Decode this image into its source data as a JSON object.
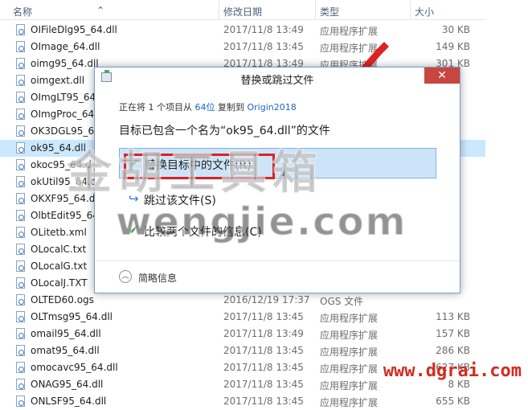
{
  "columns": {
    "name": "名称",
    "date": "修改日期",
    "type": "类型",
    "size": "大小"
  },
  "files": [
    {
      "name": "OIFileDlg95_64.dll",
      "date": "2017/11/8 13:49",
      "type": "应用程序扩展",
      "size": "30 KB"
    },
    {
      "name": "OImage_64.dll",
      "date": "2017/11/8 13:45",
      "type": "应用程序扩展",
      "size": "149 KB"
    },
    {
      "name": "oimg95_64.dll",
      "date": "2017/11/8 13:49",
      "type": "应用程序扩展",
      "size": "301 KB"
    },
    {
      "name": "oimgext.dll",
      "date": "",
      "type": "",
      "size": ""
    },
    {
      "name": "OImgLT95_64",
      "date": "",
      "type": "",
      "size": ""
    },
    {
      "name": "OImgProc_64",
      "date": "",
      "type": "",
      "size": ""
    },
    {
      "name": "OK3DGL95_6",
      "date": "",
      "type": "",
      "size": ""
    },
    {
      "name": "ok95_64.dll",
      "date": "",
      "type": "",
      "size": ""
    },
    {
      "name": "okoc95_64.d",
      "date": "",
      "type": "",
      "size": ""
    },
    {
      "name": "okUtil95_64.c",
      "date": "",
      "type": "",
      "size": ""
    },
    {
      "name": "OKXF95_64.d",
      "date": "",
      "type": "",
      "size": ""
    },
    {
      "name": "OlbtEdit95_64",
      "date": "",
      "type": "",
      "size": ""
    },
    {
      "name": "OLitetb.xml",
      "date": "",
      "type": "",
      "size": ""
    },
    {
      "name": "OLocalC.txt",
      "date": "",
      "type": "",
      "size": ""
    },
    {
      "name": "OLocalG.txt",
      "date": "",
      "type": "",
      "size": ""
    },
    {
      "name": "OLocalJ.TXT",
      "date": "",
      "type": "",
      "size": ""
    },
    {
      "name": "OLTED60.ogs",
      "date": "2016/12/19 17:37",
      "type": "OGS 文件",
      "size": ""
    },
    {
      "name": "OLTmsg95_64.dll",
      "date": "2017/11/8 13:45",
      "type": "应用程序扩展",
      "size": "113 KB"
    },
    {
      "name": "omail95_64.dll",
      "date": "2017/11/8 13:49",
      "type": "应用程序扩展",
      "size": "157 KB"
    },
    {
      "name": "omat95_64.dll",
      "date": "2017/11/8 13:45",
      "type": "应用程序扩展",
      "size": "286 KB"
    },
    {
      "name": "omocavc95_64.dll",
      "date": "2017/11/8 13:45",
      "type": "应用程序扩展",
      "size": "627 KB"
    },
    {
      "name": "ONAG95_64.dll",
      "date": "2017/11/8 13:45",
      "type": "应用程序扩展",
      "size": "8 KB"
    },
    {
      "name": "ONLSF95_64.dll",
      "date": "2017/11/8 13:45",
      "type": "应用程序扩展",
      "size": "655 KB"
    }
  ],
  "dialog": {
    "title": "替换或跳过文件",
    "close": "✕",
    "progress_prefix": "正在将 1 个项目从 ",
    "progress_src": "64位",
    "progress_mid": " 复制到 ",
    "progress_dst": "Origin2018",
    "heading": "目标已包含一个名为“ok95_64.dll”的文件",
    "replace_label": "替换目标中的文件(R)",
    "skip_label": "跳过该文件(S)",
    "compare_label": "比较两个文件的信息(C)",
    "details_label": "简略信息"
  },
  "watermark": {
    "cn": "金胡工具箱",
    "en": "wengjie.com",
    "url": "www.dgrai.com"
  },
  "colors": {
    "selection": "#cce8ff",
    "close": "#c7463f",
    "highlight": "#dc2323",
    "link": "#1e64c8"
  }
}
